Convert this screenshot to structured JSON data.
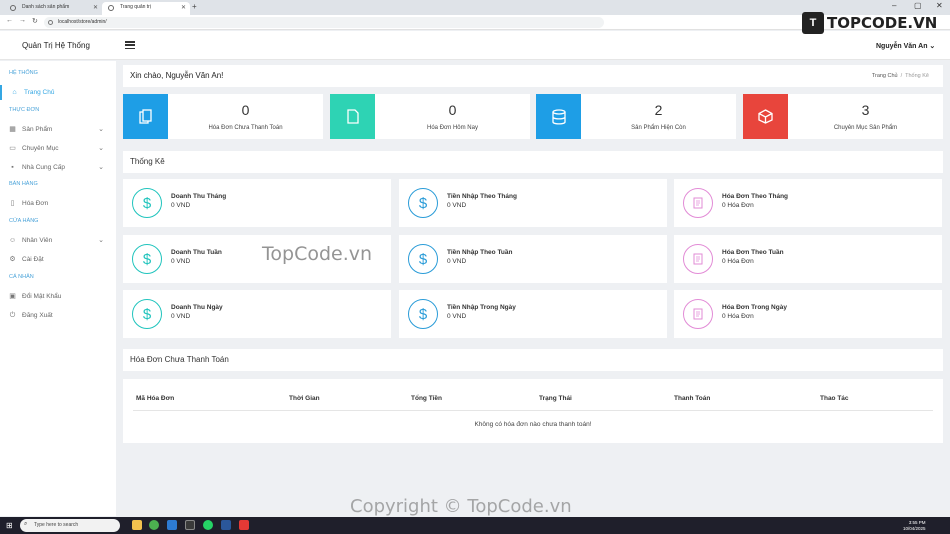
{
  "browser": {
    "tabs": [
      {
        "label": "Danh sách sản phẩm"
      },
      {
        "label": "Trang quản trị"
      }
    ],
    "url": "localhost/store/admin/"
  },
  "header": {
    "brand": "Quản Trị Hệ Thống",
    "user": "Nguyễn Văn An"
  },
  "sidebar": {
    "sections": [
      {
        "heading": "HỆ THỐNG"
      },
      {
        "heading": "THỰC ĐƠN"
      },
      {
        "heading": "BÁN HÀNG"
      },
      {
        "heading": "CỬA HÀNG"
      },
      {
        "heading": "CÁ NHÂN"
      }
    ],
    "items": [
      {
        "label": "Trang Chủ",
        "icon": "home-icon"
      },
      {
        "label": "Sản Phẩm",
        "icon": "grid-icon"
      },
      {
        "label": "Chuyên Mục",
        "icon": "folder-icon"
      },
      {
        "label": "Nhà Cung Cấp",
        "icon": "truck-icon"
      },
      {
        "label": "Hóa Đơn",
        "icon": "file-icon"
      },
      {
        "label": "Nhân Viên",
        "icon": "user-icon"
      },
      {
        "label": "Cài Đặt",
        "icon": "gear-icon"
      },
      {
        "label": "Đổi Mật Khẩu",
        "icon": "lock-icon"
      },
      {
        "label": "Đăng Xuất",
        "icon": "power-icon"
      }
    ]
  },
  "welcome": {
    "title": "Xin chào, Nguyễn Văn An!",
    "breadcrumb": [
      "Trang Chủ",
      "Thống Kê"
    ]
  },
  "stats": [
    {
      "value": "0",
      "label": "Hóa Đơn Chưa Thanh Toán",
      "color": "#1e9ee6",
      "icon": "copy-icon"
    },
    {
      "value": "0",
      "label": "Hóa Đơn Hôm Nay",
      "color": "#2ed3b4",
      "icon": "file-icon"
    },
    {
      "value": "2",
      "label": "Sản Phẩm Hiện Còn",
      "color": "#1e9ee6",
      "icon": "database-icon"
    },
    {
      "value": "3",
      "label": "Chuyên Mục Sản Phẩm",
      "color": "#e8453c",
      "icon": "box-icon"
    }
  ],
  "stats_section_title": "Thống Kê",
  "metrics": [
    {
      "title": "Doanh Thu Tháng",
      "value": "0 VND",
      "icon": "dollar-icon",
      "color": "teal"
    },
    {
      "title": "Tiền Nhập Theo Tháng",
      "value": "0 VND",
      "icon": "dollar-icon",
      "color": "blue"
    },
    {
      "title": "Hóa Đơn Theo Tháng",
      "value": "0 Hóa Đơn",
      "icon": "receipt-icon",
      "color": "pink"
    },
    {
      "title": "Doanh Thu Tuần",
      "value": "0 VND",
      "icon": "dollar-icon",
      "color": "teal"
    },
    {
      "title": "Tiền Nhập Theo Tuần",
      "value": "0 VND",
      "icon": "dollar-icon",
      "color": "blue"
    },
    {
      "title": "Hóa Đơn Theo Tuần",
      "value": "0 Hóa Đơn",
      "icon": "receipt-icon",
      "color": "pink"
    },
    {
      "title": "Doanh Thu Ngày",
      "value": "0 VND",
      "icon": "dollar-icon",
      "color": "teal"
    },
    {
      "title": "Tiền Nhập Trong Ngày",
      "value": "0 VND",
      "icon": "dollar-icon",
      "color": "blue"
    },
    {
      "title": "Hóa Đơn Trong Ngày",
      "value": "0 Hóa Đơn",
      "icon": "receipt-icon",
      "color": "pink"
    }
  ],
  "unpaid": {
    "title": "Hóa Đơn Chưa Thanh Toán",
    "columns": [
      "Mã Hóa Đơn",
      "Thời Gian",
      "Tổng Tiền",
      "Trạng Thái",
      "Thanh Toán",
      "Thao Tác"
    ],
    "empty_message": "Không có hóa đơn nào chưa thanh toán!"
  },
  "watermark": {
    "center": "TopCode.vn",
    "bottom": "Copyright © TopCode.vn",
    "logo_mark": "T",
    "logo_text": "TOPCODE.VN"
  },
  "taskbar": {
    "search_placeholder": "Type here to search",
    "time": "3:55 PM",
    "date": "10/04/2025"
  }
}
